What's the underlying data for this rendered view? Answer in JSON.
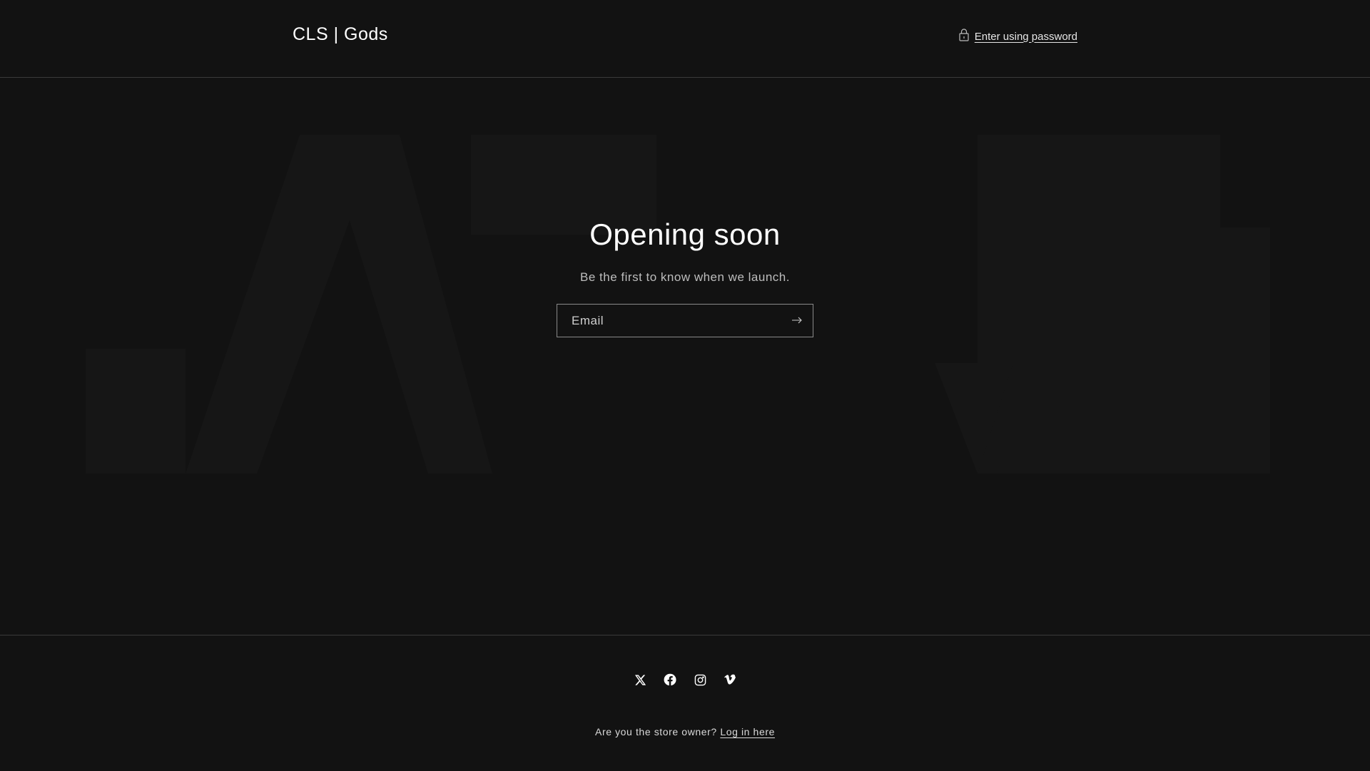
{
  "header": {
    "logo": "CLS | Gods",
    "password_link": "Enter using password"
  },
  "main": {
    "title": "Opening soon",
    "subtitle": "Be the first to know when we launch.",
    "email_placeholder": "Email",
    "email_value": ""
  },
  "footer": {
    "social": [
      {
        "name": "x-icon"
      },
      {
        "name": "facebook-icon"
      },
      {
        "name": "instagram-icon"
      },
      {
        "name": "vimeo-icon"
      }
    ],
    "owner_text": "Are you the store owner?",
    "login_link": "Log in here"
  },
  "colors": {
    "background": "#121212",
    "text": "#ffffff",
    "border": "#3a3a3a"
  }
}
